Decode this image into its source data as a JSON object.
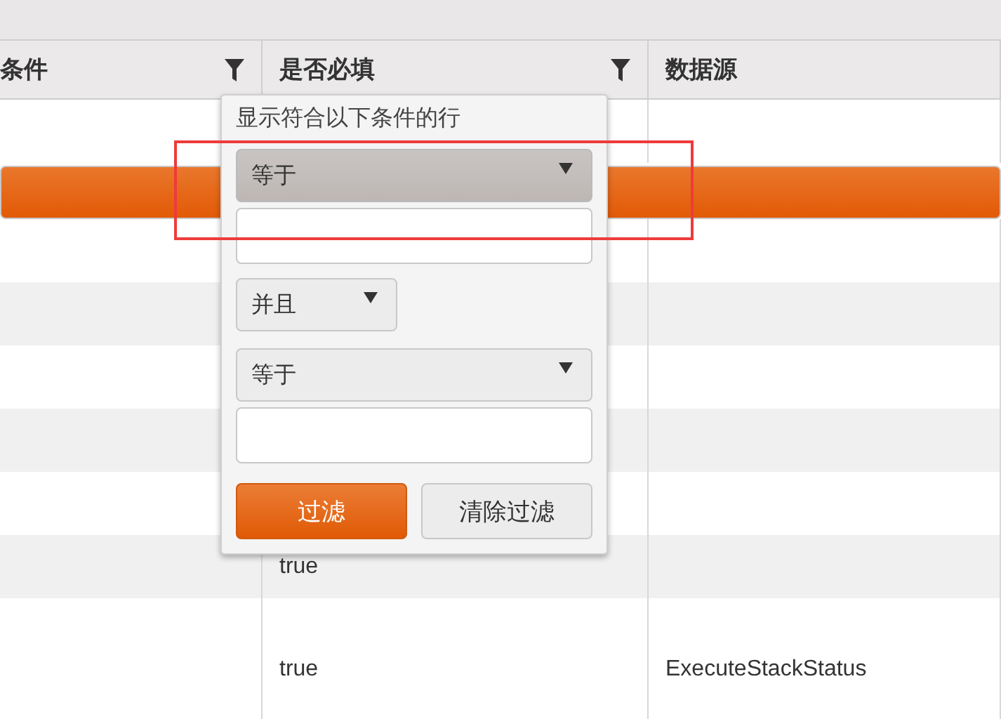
{
  "table": {
    "columns": [
      {
        "label": "条件",
        "filterable": true
      },
      {
        "label": "是否必填",
        "filterable": true
      },
      {
        "label": "数据源",
        "filterable": false
      }
    ],
    "rows": [
      {
        "selected": false
      },
      {
        "selected": true
      },
      {
        "selected": false
      },
      {
        "selected": false
      },
      {
        "selected": false
      },
      {
        "selected": false
      },
      {
        "selected": false
      },
      {
        "selected": false,
        "required": "true"
      },
      {
        "selected": false,
        "required": "true",
        "source": "ExecuteStackStatus"
      }
    ]
  },
  "filter_menu": {
    "title": "显示符合以下条件的行",
    "conditions": [
      {
        "operator": "等于",
        "focused": true
      },
      {
        "operator": "等于",
        "focused": false
      }
    ],
    "logic": "并且",
    "buttons": [
      {
        "label": "过滤",
        "kind": "primary"
      },
      {
        "label": "清除过滤",
        "kind": "secondary"
      }
    ]
  }
}
